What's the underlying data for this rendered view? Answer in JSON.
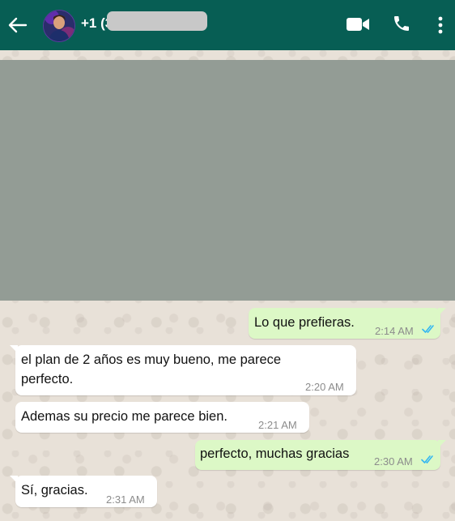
{
  "header": {
    "contact_name": "+1 (3",
    "back_icon": "arrow-left-icon",
    "video_icon": "video-camera-icon",
    "call_icon": "phone-icon",
    "menu_icon": "kebab-menu-icon",
    "colors": {
      "header_bg": "#075e54",
      "tick_blue": "#34b7f1"
    }
  },
  "chat": {
    "media": {
      "type": "image-placeholder",
      "color": "#939c95"
    },
    "messages": [
      {
        "direction": "outgoing",
        "text": "Lo que prefieras.",
        "time": "2:14 AM",
        "status": "read"
      },
      {
        "direction": "incoming",
        "text_line1": "el plan de 2 años es muy bueno, me parece",
        "text_line2": "perfecto.",
        "time": "2:20 AM"
      },
      {
        "direction": "incoming",
        "text": "Ademas su precio me parece bien.",
        "time": "2:21 AM"
      },
      {
        "direction": "outgoing",
        "text": "perfecto, muchas gracias",
        "time": "2:30 AM",
        "status": "read"
      },
      {
        "direction": "incoming",
        "text": "Sí, gracias.",
        "time": "2:31 AM"
      }
    ]
  }
}
